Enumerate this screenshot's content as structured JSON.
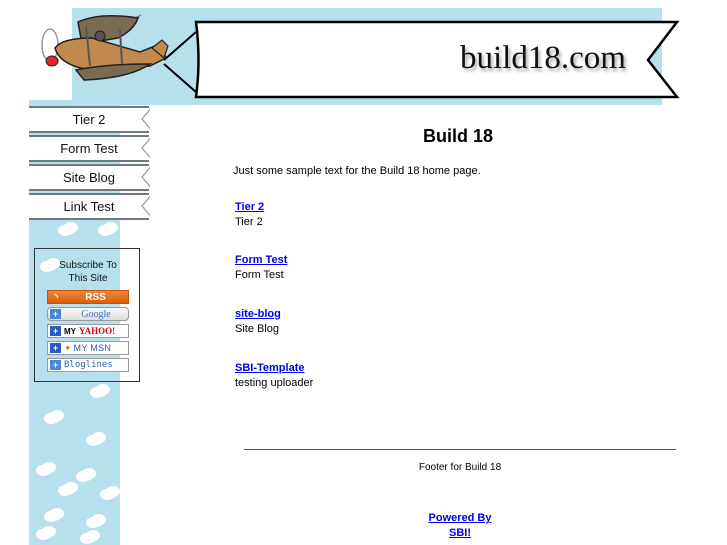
{
  "header": {
    "site_title": "build18.com",
    "logo_icon": "biplane-icon",
    "colors": {
      "sky": "#b6e0ec",
      "banner": "#ffffff",
      "outline": "#000000"
    }
  },
  "nav": {
    "items": [
      {
        "label": "Tier 2"
      },
      {
        "label": "Form Test"
      },
      {
        "label": "Site Blog"
      },
      {
        "label": "Link Test"
      }
    ]
  },
  "subscribe": {
    "title_line1": "Subscribe To",
    "title_line2": "This Site",
    "buttons": {
      "rss": "RSS",
      "google": "Google",
      "yahoo_my": "MY",
      "yahoo_brand": "YAHOO!",
      "msn": "MY MSN",
      "bloglines": "Bloglines"
    }
  },
  "main": {
    "title": "Build 18",
    "intro": "Just some sample text for the Build 18 home page.",
    "entries": [
      {
        "link": "Tier 2",
        "desc": "Tier 2"
      },
      {
        "link": "Form Test",
        "desc": "Form Test"
      },
      {
        "link": "site-blog",
        "desc": "Site Blog"
      },
      {
        "link": "SBI-Template",
        "desc": "testing uploader"
      }
    ],
    "link_color": "#0000ee"
  },
  "footer": {
    "text": "Footer for Build 18",
    "powered_line1": "Powered By",
    "powered_line2": "SBI!"
  }
}
